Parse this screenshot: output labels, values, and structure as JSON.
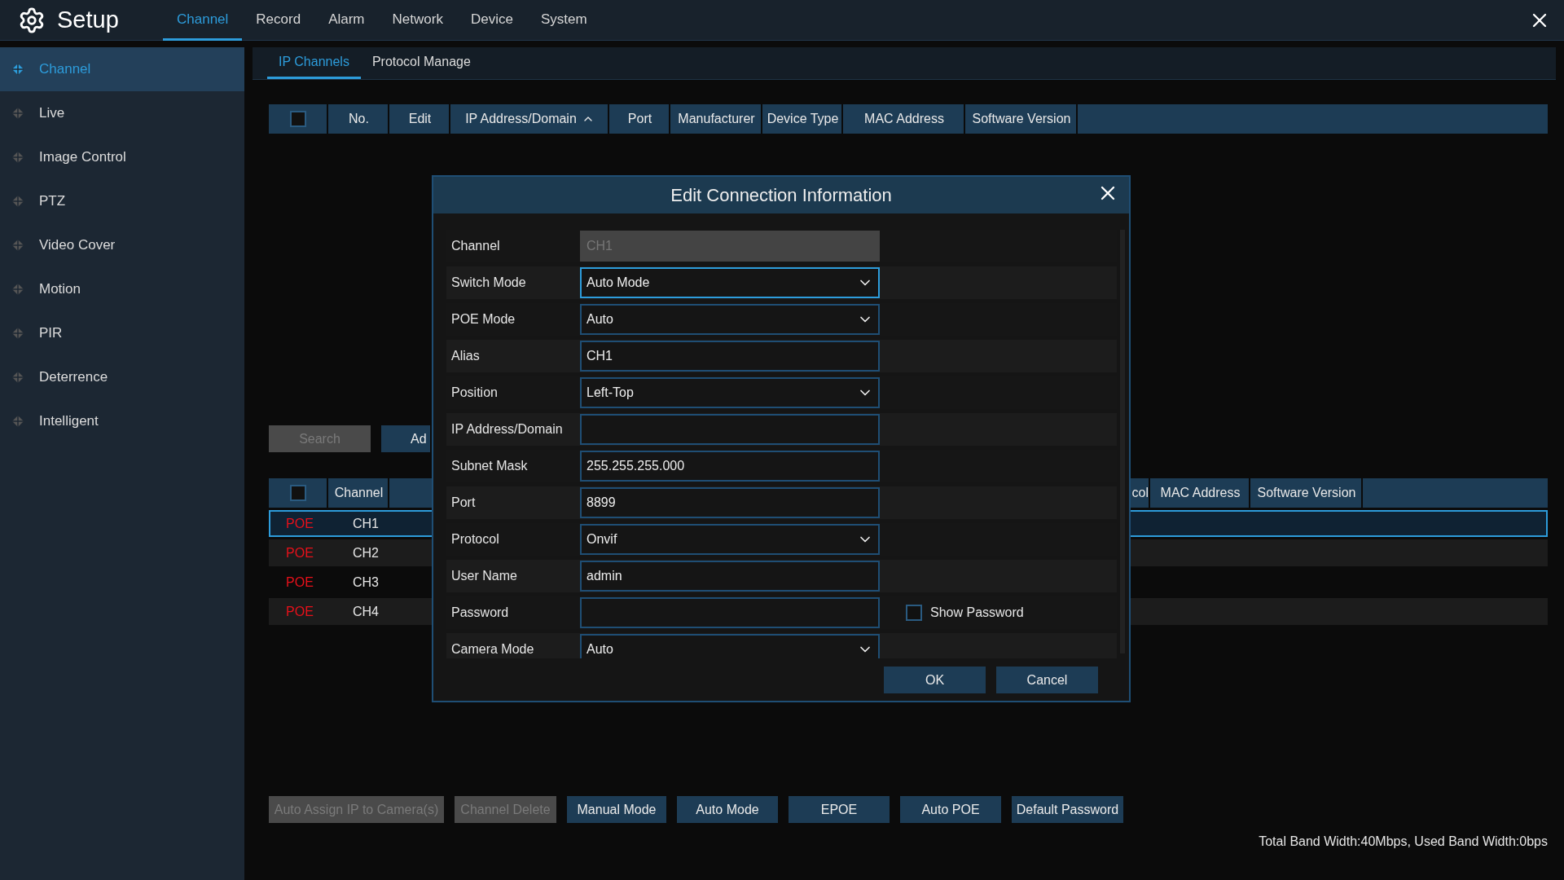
{
  "header": {
    "title": "Setup",
    "tabs": [
      {
        "label": "Channel",
        "selected": true
      },
      {
        "label": "Record",
        "selected": false
      },
      {
        "label": "Alarm",
        "selected": false
      },
      {
        "label": "Network",
        "selected": false
      },
      {
        "label": "Device",
        "selected": false
      },
      {
        "label": "System",
        "selected": false
      }
    ]
  },
  "sidebar": {
    "items": [
      {
        "label": "Channel",
        "selected": true
      },
      {
        "label": "Live",
        "selected": false
      },
      {
        "label": "Image Control",
        "selected": false
      },
      {
        "label": "PTZ",
        "selected": false
      },
      {
        "label": "Video Cover",
        "selected": false
      },
      {
        "label": "Motion",
        "selected": false
      },
      {
        "label": "PIR",
        "selected": false
      },
      {
        "label": "Deterrence",
        "selected": false
      },
      {
        "label": "Intelligent",
        "selected": false
      }
    ]
  },
  "subtabs": [
    {
      "label": "IP Channels",
      "selected": true
    },
    {
      "label": "Protocol Manage",
      "selected": false
    }
  ],
  "device_table": {
    "select_all": {
      "checked": false
    },
    "columns": [
      {
        "label": "No."
      },
      {
        "label": "Edit"
      },
      {
        "label": "IP Address/Domain",
        "sort_ascending": true
      },
      {
        "label": "Port"
      },
      {
        "label": "Manufacturer"
      },
      {
        "label": "Device Type"
      },
      {
        "label": "MAC Address"
      },
      {
        "label": "Software Version"
      }
    ]
  },
  "search_buttons": [
    {
      "label": "Search",
      "disabled": true
    },
    {
      "label": "Ad",
      "disabled": false
    }
  ],
  "channel_table": {
    "select_all": {
      "checked": false
    },
    "left_columns": [
      "Channel"
    ],
    "right_columns": [
      "col",
      "MAC Address",
      "Software Version"
    ],
    "rows": [
      {
        "type": "POE",
        "channel": "CH1",
        "selected": true
      },
      {
        "type": "POE",
        "channel": "CH2",
        "selected": false
      },
      {
        "type": "POE",
        "channel": "CH3",
        "selected": false
      },
      {
        "type": "POE",
        "channel": "CH4",
        "selected": false
      }
    ]
  },
  "bottom_buttons": [
    {
      "label": "Auto Assign IP to Camera(s)",
      "disabled": true
    },
    {
      "label": "Channel Delete",
      "disabled": true
    },
    {
      "label": "Manual Mode",
      "disabled": false
    },
    {
      "label": "Auto Mode",
      "disabled": false
    },
    {
      "label": "EPOE",
      "disabled": false
    },
    {
      "label": "Auto POE",
      "disabled": false
    },
    {
      "label": "Default Password",
      "disabled": false
    }
  ],
  "status": "Total Band Width:40Mbps, Used Band Width:0bps",
  "dialog": {
    "title": "Edit Connection Information",
    "fields": [
      {
        "label": "Channel",
        "kind": "text",
        "value": "CH1",
        "disabled": true
      },
      {
        "label": "Switch Mode",
        "kind": "select",
        "value": "Auto Mode",
        "focused": true
      },
      {
        "label": "POE Mode",
        "kind": "select",
        "value": "Auto"
      },
      {
        "label": "Alias",
        "kind": "text",
        "value": "CH1"
      },
      {
        "label": "Position",
        "kind": "select",
        "value": "Left-Top"
      },
      {
        "label": "IP Address/Domain",
        "kind": "text"
      },
      {
        "label": "Subnet Mask",
        "kind": "text",
        "value": "255.255.255.000"
      },
      {
        "label": "Port",
        "kind": "text",
        "value": "8899"
      },
      {
        "label": "Protocol",
        "kind": "select",
        "value": "Onvif"
      },
      {
        "label": "User Name",
        "kind": "text",
        "value": "admin"
      },
      {
        "label": "Password",
        "kind": "password",
        "option": {
          "label": "Show Password",
          "checked": false
        }
      },
      {
        "label": "Camera Mode",
        "kind": "select",
        "value": "Auto"
      }
    ],
    "buttons": [
      {
        "label": "OK"
      },
      {
        "label": "Cancel"
      }
    ]
  }
}
